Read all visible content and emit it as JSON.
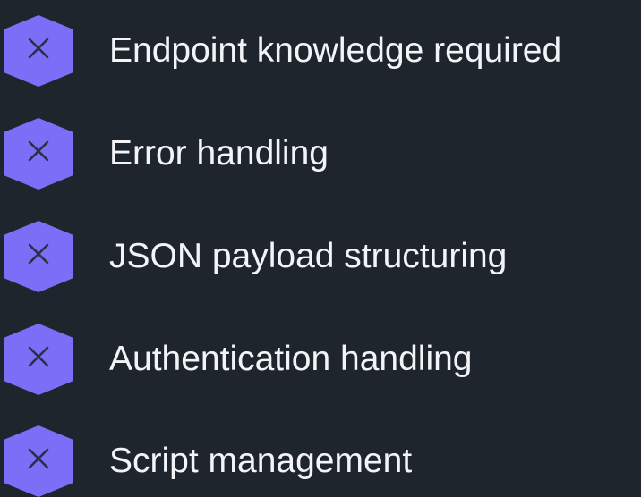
{
  "theme": {
    "background": "#1f252d",
    "accent": "#7c6ff7",
    "icon_stroke": "#2a3040",
    "text": "#f3f4f7"
  },
  "list": {
    "icon": "x-mark-hexagon-icon",
    "items": [
      {
        "label": "Endpoint knowledge required"
      },
      {
        "label": "Error handling"
      },
      {
        "label": "JSON payload structuring"
      },
      {
        "label": "Authentication handling"
      },
      {
        "label": "Script management"
      }
    ]
  }
}
